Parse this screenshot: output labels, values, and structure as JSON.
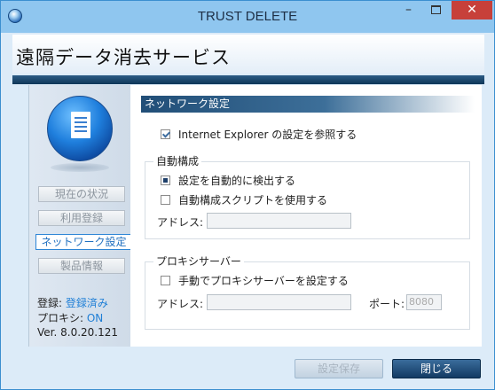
{
  "window": {
    "title": "TRUST DELETE",
    "minimize": "–",
    "close": "✕"
  },
  "header": {
    "title": "遠隔データ消去サービス"
  },
  "sidebar": {
    "items": [
      {
        "label": "現在の状況"
      },
      {
        "label": "利用登録"
      },
      {
        "label": "ネットワーク設定"
      },
      {
        "label": "製品情報"
      }
    ],
    "active_index": 2,
    "status": {
      "registration_label": "登録: ",
      "registration_value": "登録済み",
      "proxy_label": "プロキシ: ",
      "proxy_value": "ON",
      "version": "Ver. 8.0.20.121"
    }
  },
  "network": {
    "section_title": "ネットワーク設定",
    "use_ie_settings": {
      "label": "Internet Explorer の設定を参照する",
      "checked": true
    },
    "auto_config": {
      "group_title": "自動構成",
      "auto_detect": {
        "label": "設定を自動的に検出する",
        "state": "indeterminate"
      },
      "use_script": {
        "label": "自動構成スクリプトを使用する",
        "checked": false
      },
      "address_label": "アドレス:",
      "address_value": ""
    },
    "proxy_server": {
      "group_title": "プロキシサーバー",
      "manual": {
        "label": "手動でプロキシサーバーを設定する",
        "checked": false
      },
      "address_label": "アドレス:",
      "address_value": "",
      "port_label": "ポート:",
      "port_value": "8080"
    }
  },
  "buttons": {
    "save": "設定保存",
    "close": "閉じる"
  },
  "colors": {
    "titlebar": "#8fc6ef",
    "accent": "#1f7fd6",
    "close_btn": "#c7403a",
    "dark_btn": "#123a63"
  }
}
